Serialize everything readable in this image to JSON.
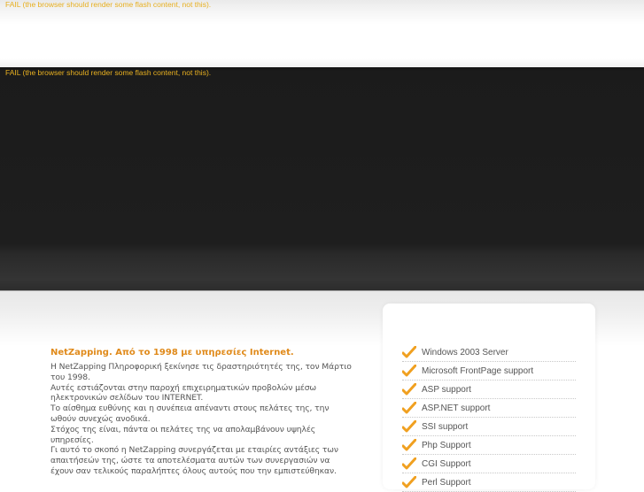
{
  "flash_fallback": {
    "top_message": "FAIL (the browser should render some flash content, not this).",
    "banner_message": "FAIL (the browser should render some flash content, not this)."
  },
  "about": {
    "title": "NetZapping. Από το 1998 με υπηρεσίες Internet.",
    "lines": [
      "Η NetZapping Πληροφορική ξεκίνησε τις δραστηριότητές της, τον Μάρτιο του 1998.",
      "Αυτές εστιάζονται στην παροχή επιχειρηματικών προβολών μέσω ηλεκτρονικών σελίδων του INTERNET.",
      "Το αίσθημα ευθύνης και η συνέπεια απέναντι στους πελάτες της, την ωθούν συνεχώς ανοδικά.",
      "Στόχος της είναι, πάντα οι πελάτες της να απολαμβάνουν υψηλές υπηρεσίες.",
      "Γι αυτό το σκοπό η NetZapping συνεργάζεται με εταιρίες αντάξιες των απαιτήσεών της, ώστε τα αποτελέσματα αυτών των συνεργασιών να έχουν σαν τελικούς παραλήπτες όλους αυτούς που την εμπιστεύθηκαν."
    ]
  },
  "support_list": {
    "icon": "check-icon",
    "items": [
      "Windows 2003 Server",
      "Microsoft FrontPage support",
      "ASP support",
      "ASP.NET support",
      "SSI support",
      "Php Support",
      "CGI Support",
      "Perl Support"
    ]
  },
  "colors": {
    "accent": "#e08a1a",
    "fail_text": "#e8b020",
    "banner": "#1e1e1e",
    "body_text": "#555555"
  }
}
